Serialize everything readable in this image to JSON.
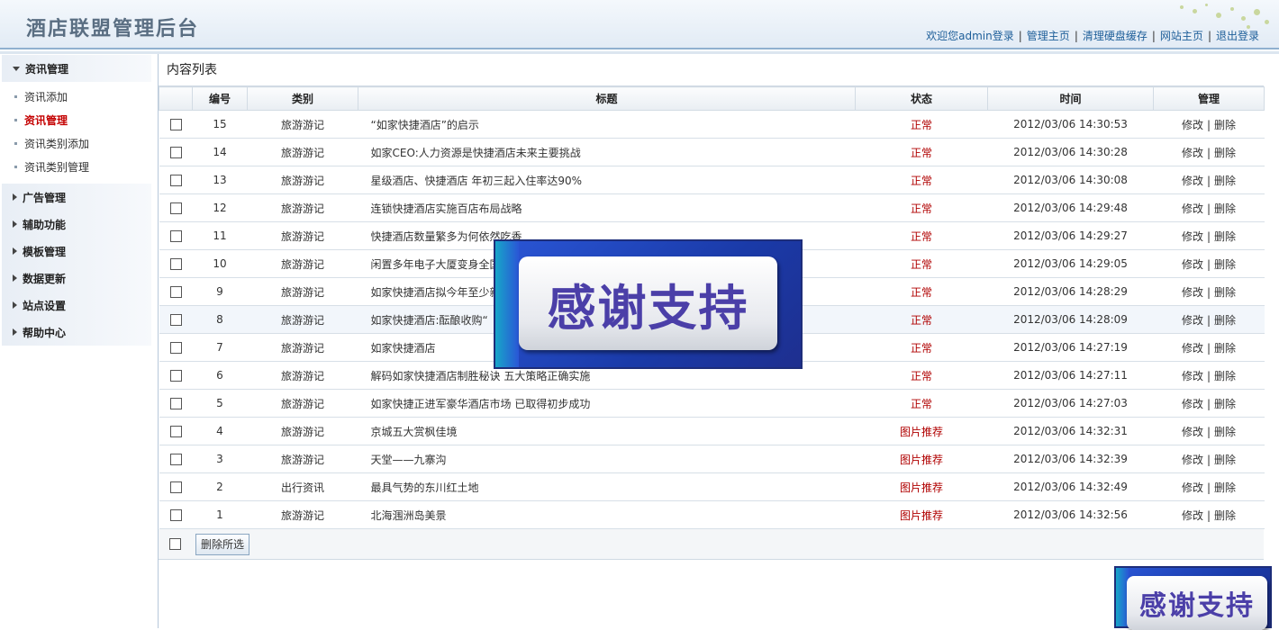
{
  "header": {
    "title": "酒店联盟管理后台",
    "welcome": "欢迎您admin登录",
    "links": [
      "管理主页",
      "清理硬盘缓存",
      "网站主页",
      "退出登录"
    ]
  },
  "sidebar": {
    "groups": [
      {
        "label": "资讯管理",
        "expanded": true,
        "items": [
          "资讯添加",
          "资讯管理",
          "资讯类别添加",
          "资讯类别管理"
        ]
      },
      {
        "label": "广告管理",
        "expanded": false
      },
      {
        "label": "辅助功能",
        "expanded": false
      },
      {
        "label": "模板管理",
        "expanded": false
      },
      {
        "label": "数据更新",
        "expanded": false
      },
      {
        "label": "站点设置",
        "expanded": false
      },
      {
        "label": "帮助中心",
        "expanded": false
      }
    ],
    "active_item": "资讯管理"
  },
  "content": {
    "title": "内容列表",
    "columns": [
      "",
      "编号",
      "类别",
      "标题",
      "状态",
      "时间",
      "管理"
    ],
    "rows": [
      {
        "id": "15",
        "category": "旅游游记",
        "title": "“如家快捷酒店”的启示",
        "status": "正常",
        "time": "2012/03/06 14:30:53"
      },
      {
        "id": "14",
        "category": "旅游游记",
        "title": "如家CEO:人力资源是快捷酒店未来主要挑战",
        "status": "正常",
        "time": "2012/03/06 14:30:28"
      },
      {
        "id": "13",
        "category": "旅游游记",
        "title": "星级酒店、快捷酒店 年初三起入住率达90%",
        "status": "正常",
        "time": "2012/03/06 14:30:08"
      },
      {
        "id": "12",
        "category": "旅游游记",
        "title": "连锁快捷酒店实施百店布局战略",
        "status": "正常",
        "time": "2012/03/06 14:29:48"
      },
      {
        "id": "11",
        "category": "旅游游记",
        "title": "快捷酒店数量繁多为何依然吃香",
        "status": "正常",
        "time": "2012/03/06 14:29:27"
      },
      {
        "id": "10",
        "category": "旅游游记",
        "title": "闲置多年电子大厦变身全国",
        "status": "正常",
        "time": "2012/03/06 14:29:05"
      },
      {
        "id": "9",
        "category": "旅游游记",
        "title": "如家快捷酒店拟今年至少新",
        "status": "正常",
        "time": "2012/03/06 14:28:29"
      },
      {
        "id": "8",
        "category": "旅游游记",
        "title": "如家快捷酒店:酝酿收购“",
        "status": "正常",
        "time": "2012/03/06 14:28:09"
      },
      {
        "id": "7",
        "category": "旅游游记",
        "title": "如家快捷酒店",
        "status": "正常",
        "time": "2012/03/06 14:27:19"
      },
      {
        "id": "6",
        "category": "旅游游记",
        "title": "解码如家快捷酒店制胜秘诀 五大策略正确实施",
        "status": "正常",
        "time": "2012/03/06 14:27:11"
      },
      {
        "id": "5",
        "category": "旅游游记",
        "title": "如家快捷正进军豪华酒店市场 已取得初步成功",
        "status": "正常",
        "time": "2012/03/06 14:27:03"
      },
      {
        "id": "4",
        "category": "旅游游记",
        "title": "京城五大赏枫佳境",
        "status": "图片推荐",
        "time": "2012/03/06 14:32:31"
      },
      {
        "id": "3",
        "category": "旅游游记",
        "title": "天堂——九寨沟",
        "status": "图片推荐",
        "time": "2012/03/06 14:32:39"
      },
      {
        "id": "2",
        "category": "出行资讯",
        "title": "最具气势的东川红土地",
        "status": "图片推荐",
        "time": "2012/03/06 14:32:49"
      },
      {
        "id": "1",
        "category": "旅游游记",
        "title": "北海涠洲岛美景",
        "status": "图片推荐",
        "time": "2012/03/06 14:32:56"
      }
    ],
    "ops": {
      "edit": "修改",
      "delete": "删除",
      "sep": "|"
    },
    "delete_selected": "删除所选"
  },
  "overlays": {
    "banner_text": "感谢支持"
  },
  "colors": {
    "status_red": "#b00000",
    "link_blue": "#1d5e99",
    "banner_blue": "#2a56d6",
    "banner_text": "#4b3fa8"
  }
}
